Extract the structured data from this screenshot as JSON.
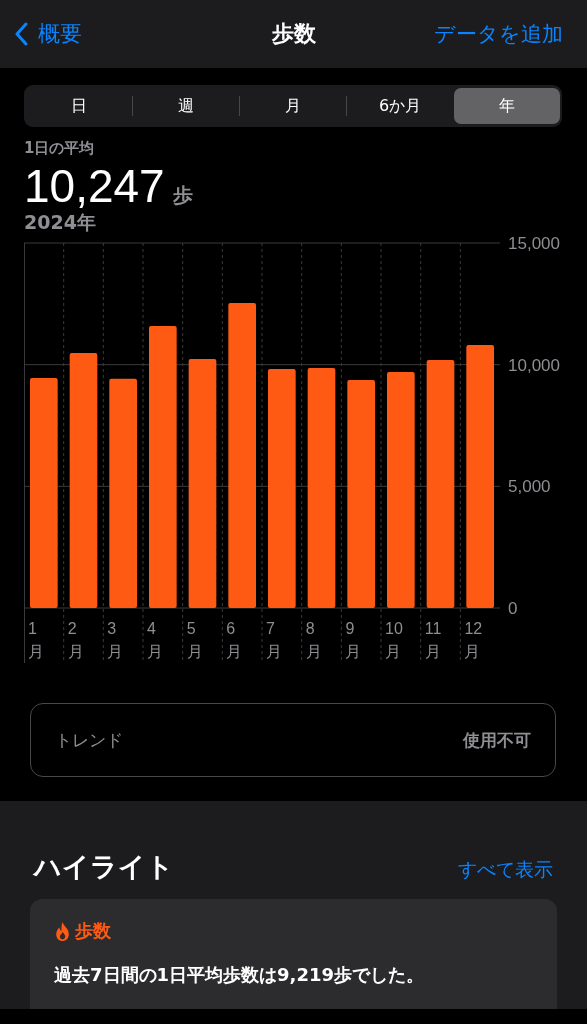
{
  "nav": {
    "back": "概要",
    "title": "歩数",
    "action": "データを追加"
  },
  "segments": [
    {
      "label": "日",
      "selected": false
    },
    {
      "label": "週",
      "selected": false
    },
    {
      "label": "月",
      "selected": false
    },
    {
      "label": "6か月",
      "selected": false
    },
    {
      "label": "年",
      "selected": true
    }
  ],
  "summary": {
    "label": "1日の平均",
    "value": "10,247",
    "unit": "歩",
    "period": "2024年"
  },
  "chart": {
    "chart_data": {
      "type": "bar",
      "categories": [
        "1月",
        "2月",
        "3月",
        "4月",
        "5月",
        "6月",
        "7月",
        "8月",
        "9月",
        "10月",
        "11月",
        "12月"
      ],
      "series": [
        {
          "color": "#ff5a14",
          "values": [
            9450,
            10480,
            9420,
            11590,
            10230,
            12530,
            9820,
            9860,
            9370,
            9700,
            10190,
            10810
          ]
        }
      ],
      "ylim": [
        0,
        15000
      ],
      "yticks": [
        {
          "value": 0,
          "label": "0"
        },
        {
          "value": 5000,
          "label": "5,000"
        },
        {
          "value": 10000,
          "label": "10,000"
        },
        {
          "value": 15000,
          "label": "15,000"
        }
      ]
    }
  },
  "trend": {
    "label": "トレンド",
    "value": "使用不可"
  },
  "highlights": {
    "title": "ハイライト",
    "link": "すべて表示",
    "card": {
      "category": "歩数",
      "text": "過去7日間の1日平均歩数は9,219歩でした。"
    }
  }
}
